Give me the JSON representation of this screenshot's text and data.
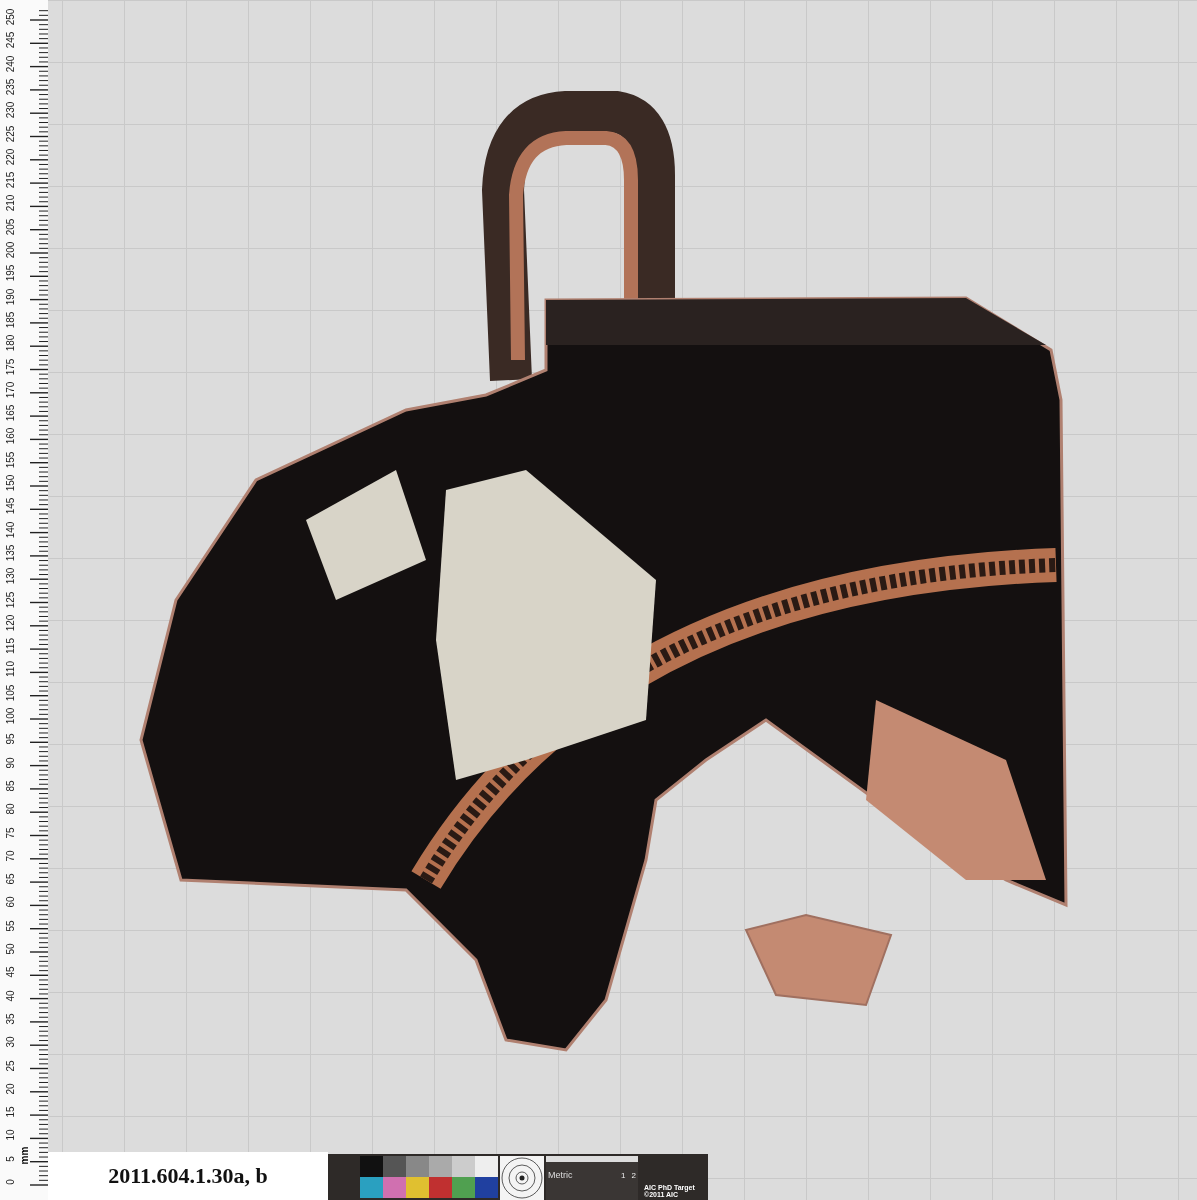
{
  "ruler": {
    "unit": "mm",
    "labels": [
      "0",
      "5",
      "10",
      "15",
      "20",
      "25",
      "30",
      "35",
      "40",
      "45",
      "50",
      "55",
      "60",
      "65",
      "70",
      "75",
      "80",
      "85",
      "90",
      "95",
      "100",
      "105",
      "110",
      "115",
      "120",
      "125",
      "130",
      "135",
      "140",
      "145",
      "150",
      "155",
      "160",
      "165",
      "170",
      "175",
      "180",
      "185",
      "190",
      "195",
      "200",
      "205",
      "210",
      "215",
      "220",
      "225",
      "230",
      "235",
      "240",
      "245",
      "250"
    ]
  },
  "label_card": {
    "text": "2011.604.1.30a, b"
  },
  "color_target": {
    "swatches": [
      {
        "color": "#111111"
      },
      {
        "color": "#555555"
      },
      {
        "color": "#888888"
      },
      {
        "color": "#aaaaaa"
      },
      {
        "color": "#cccccc"
      },
      {
        "color": "#eeeeee"
      },
      {
        "color": "#2aa0c0"
      },
      {
        "color": "#d070b0"
      },
      {
        "color": "#e0c030"
      },
      {
        "color": "#c03030"
      },
      {
        "color": "#50a050"
      },
      {
        "color": "#2040a0"
      }
    ],
    "scale_labels": [
      "Metric",
      "1",
      "2"
    ],
    "caption": [
      "AIC PhD Target",
      "©2011 AIC"
    ]
  }
}
